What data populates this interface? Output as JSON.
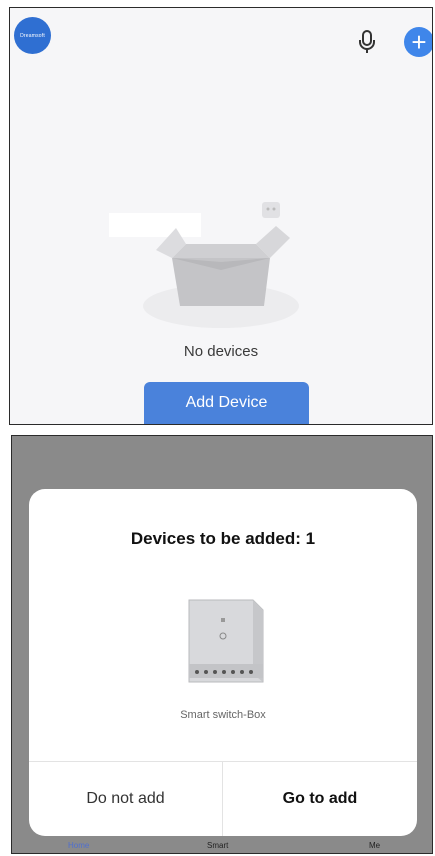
{
  "header": {
    "logo_text": "Dreamsoft"
  },
  "empty_state": {
    "label": "No devices",
    "add_button": "Add Device"
  },
  "dialog": {
    "title": "Devices to be added: 1",
    "device_name": "Smart switch-Box",
    "cancel_label": "Do not add",
    "confirm_label": "Go to add"
  },
  "tabbar": {
    "home": "Home",
    "smart": "Smart",
    "me": "Me"
  },
  "colors": {
    "accent": "#4a82db",
    "plus": "#3f86ea",
    "logo": "#2f6fd2",
    "overlay": "#8a8a8a"
  }
}
